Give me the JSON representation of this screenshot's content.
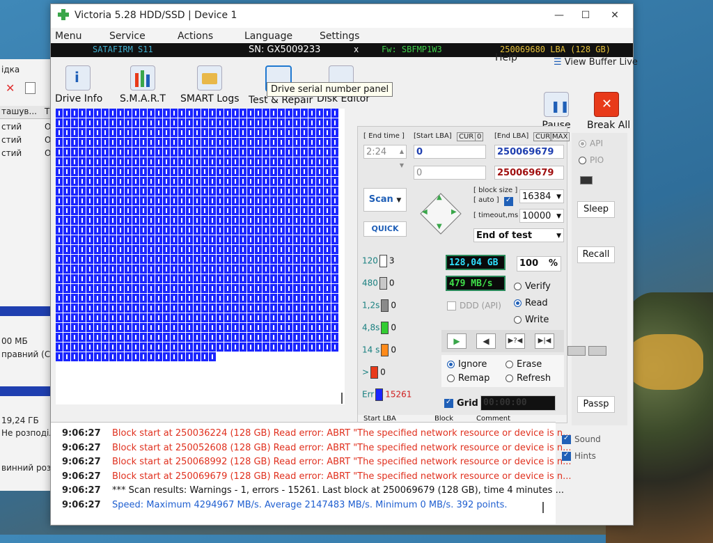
{
  "window": {
    "title": "Victoria 5.28 HDD/SSD | Device 1"
  },
  "menu": [
    "Menu",
    "Service",
    "Actions",
    "Language",
    "Settings",
    "Help"
  ],
  "view_buffer": "View Buffer Live",
  "infobar": {
    "fw_left": "SATAFIRM   S11",
    "sn": "SN: GX5009233",
    "x": "x",
    "fw": "Fw: SBFMP1W3",
    "lba": "250069680 LBA (128 GB)"
  },
  "toolbar": {
    "drive_info": "Drive Info",
    "smart": "S.M.A.R.T",
    "smart_logs": "SMART Logs",
    "test_repair": "Test & Repair",
    "disk_editor": "Disk Editor",
    "pause": "Pause",
    "break_all": "Break All"
  },
  "tooltip": "Drive serial number panel",
  "controls": {
    "end_time_label": "[ End time ]",
    "end_time": "2:24",
    "start_lba_label": "[Start LBA]",
    "cur": "CUR",
    "cur_zero": "0",
    "start_lba": "0",
    "start_lba2": "0",
    "end_lba_label": "[End LBA]",
    "max": "MAX",
    "end_lba": "250069679",
    "end_lba2": "250069679",
    "scan": "Scan",
    "quick": "QUICK",
    "block_size_label": "[ block size ]",
    "auto_label": "[ auto ]",
    "block_size": "16384",
    "timeout_label": "[ timeout,ms ]",
    "timeout": "10000",
    "end_of_test": "End of test",
    "size_gb": "128,04 GB",
    "percent": "100",
    "pct_sign": "%",
    "speed": "479 MB/s",
    "ddd": "DDD (API)",
    "verify": "Verify",
    "read": "Read",
    "write": "Write",
    "ignore": "Ignore",
    "erase": "Erase",
    "remap": "Remap",
    "refresh": "Refresh",
    "grid": "Grid",
    "timer": "00:00:00",
    "col_start": "Start LBA",
    "col_block": "Block",
    "col_comment": "Comment"
  },
  "legend": [
    {
      "label": "120",
      "count": "3",
      "color": "#ffffff"
    },
    {
      "label": "480",
      "count": "0",
      "color": "#c8c8c8"
    },
    {
      "label": "1,2s",
      "count": "0",
      "color": "#8a8a8a"
    },
    {
      "label": "4,8s",
      "count": "0",
      "color": "#33cc33"
    },
    {
      "label": "14 s",
      "count": "0",
      "color": "#ff8a1a"
    },
    {
      "label": ">",
      "count": "0",
      "color": "#e83a1a"
    },
    {
      "label": "Err",
      "count": "15261",
      "color": "#1a25ff"
    }
  ],
  "side": {
    "api": "API",
    "pio": "PIO",
    "sleep": "Sleep",
    "recall": "Recall",
    "passp": "Passp"
  },
  "log_options": {
    "sound": "Sound",
    "hints": "Hints"
  },
  "log": [
    {
      "time": "9:06:27",
      "text": "Block start at 250036224 (128 GB) Read error: ABRT \"The specified network resource or device is n...",
      "color": "#e0301e"
    },
    {
      "time": "9:06:27",
      "text": "Block start at 250052608 (128 GB) Read error: ABRT \"The specified network resource or device is n...",
      "color": "#e0301e"
    },
    {
      "time": "9:06:27",
      "text": "Block start at 250068992 (128 GB) Read error: ABRT \"The specified network resource or device is n...",
      "color": "#e0301e"
    },
    {
      "time": "9:06:27",
      "text": "Block start at 250069679 (128 GB) Read error: ABRT \"The specified network resource or device is n...",
      "color": "#e0301e"
    },
    {
      "time": "9:06:27",
      "text": "*** Scan results: Warnings - 1, errors - 15261. Last block at 250069679 (128 GB), time 4 minutes ...",
      "color": "#111111"
    },
    {
      "time": "9:06:27",
      "text": "Speed: Maximum 4294967 MB/s. Average 2147483 MB/s. Minimum 0 MB/s. 392 points.",
      "color": "#1f5fd0"
    }
  ],
  "bg_window": {
    "items": [
      "ідка",
      "ташув...",
      "стий",
      "стий",
      "стий",
      "00 МБ",
      "правний (С",
      "19,24 ГБ",
      "Не розподіле",
      "винний розд"
    ],
    "col_t": "Т",
    "o": "О"
  }
}
